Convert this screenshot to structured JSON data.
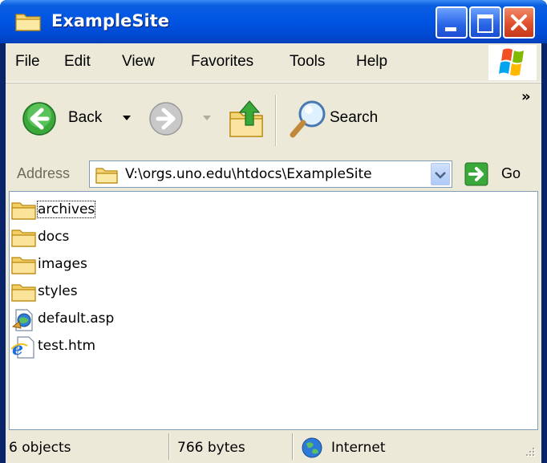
{
  "window": {
    "title": "ExampleSite"
  },
  "menu": {
    "items": [
      "File",
      "Edit",
      "View",
      "Favorites",
      "Tools",
      "Help"
    ]
  },
  "toolbar": {
    "back_label": "Back",
    "search_label": "Search",
    "chevron": "»"
  },
  "address": {
    "label": "Address",
    "value": "V:\\orgs.uno.edu\\htdocs\\ExampleSite",
    "go_label": "Go"
  },
  "files": [
    {
      "name": "archives",
      "type": "folder",
      "icon": "folder-icon"
    },
    {
      "name": "docs",
      "type": "folder",
      "icon": "folder-icon"
    },
    {
      "name": "images",
      "type": "folder",
      "icon": "folder-icon"
    },
    {
      "name": "styles",
      "type": "folder",
      "icon": "folder-icon"
    },
    {
      "name": "default.asp",
      "type": "asp",
      "icon": "asp-file-icon"
    },
    {
      "name": "test.htm",
      "type": "htm",
      "icon": "ie-file-icon"
    }
  ],
  "status": {
    "objects": "6 objects",
    "size": "766 bytes",
    "zone": "Internet"
  },
  "colors": {
    "title_bar": "#0054e3",
    "client_bg": "#ece9d8",
    "close_button": "#e0502c"
  }
}
